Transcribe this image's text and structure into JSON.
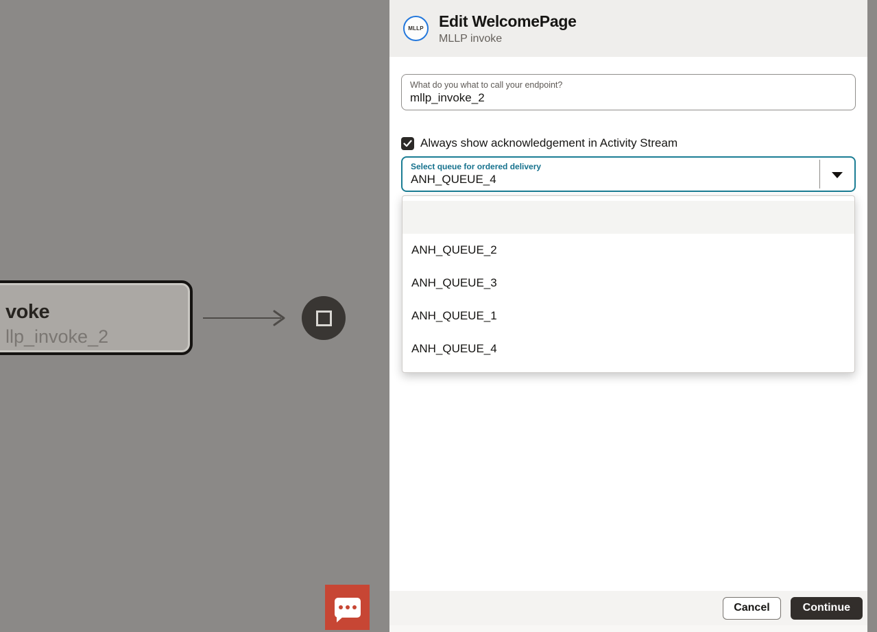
{
  "canvas": {
    "node": {
      "title_fragment": "voke",
      "subtitle_fragment": "llp_invoke_2"
    }
  },
  "drawer": {
    "badge_label": "MLLP",
    "title": "Edit WelcomePage",
    "subtitle": "MLLP invoke",
    "endpoint_field": {
      "label": "What do you what to call your endpoint?",
      "value": "mllp_invoke_2"
    },
    "ack_checkbox": {
      "label": "Always show acknowledgement in Activity Stream",
      "checked": true
    },
    "queue_select": {
      "label": "Select queue for ordered delivery",
      "value": "ANH_QUEUE_4"
    },
    "queue_options": [
      "",
      "ANH_QUEUE_2",
      "ANH_QUEUE_3",
      "ANH_QUEUE_1",
      "ANH_QUEUE_4"
    ],
    "footer": {
      "cancel_label": "Cancel",
      "continue_label": "Continue"
    }
  },
  "colors": {
    "badge_border_blue": "#2277dc",
    "focus_teal": "#1a7d94",
    "chat_red": "#c74634",
    "dark_button": "#322e2b",
    "overlay_gray": "#8b8987",
    "header_bg": "#efeeec",
    "footer_bg": "#f4f3f1"
  }
}
